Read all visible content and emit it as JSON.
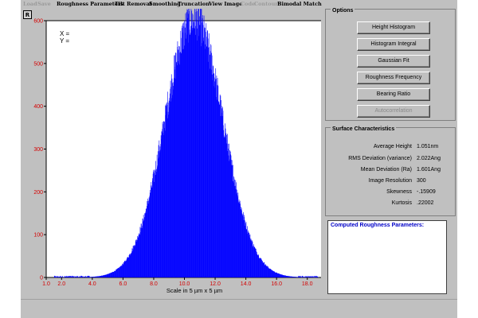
{
  "menu": [
    {
      "label": "Load",
      "enabled": false
    },
    {
      "label": "Save",
      "enabled": false
    },
    {
      "label": "Roughness Parameters",
      "enabled": true
    },
    {
      "label": "Tilt Removal",
      "enabled": true
    },
    {
      "label": "Smoothing",
      "enabled": true
    },
    {
      "label": "Truncation",
      "enabled": true
    },
    {
      "label": "View Image",
      "enabled": true
    },
    {
      "label": "Code",
      "enabled": false
    },
    {
      "label": "Contour",
      "enabled": false
    },
    {
      "label": "Bimodal Match",
      "enabled": true
    }
  ],
  "toolbar": {
    "r_label": "R"
  },
  "cursor_readout": {
    "x_label": "X =",
    "y_label": "Y ="
  },
  "chart_data": {
    "type": "bar",
    "title": "",
    "xlabel": "Scale in 5 µm x 5 µm",
    "ylabel": "",
    "xlim": [
      1.0,
      19.0
    ],
    "ylim": [
      0,
      600
    ],
    "x_ticks": [
      "1.0",
      "2.0",
      "4.0",
      "6.0",
      "8.0",
      "10.0",
      "12.0",
      "14.0",
      "16.0",
      "18.0"
    ],
    "y_ticks": [
      "0",
      "100",
      "200",
      "300",
      "400",
      "500",
      "600"
    ],
    "bar_color": "#0000ff",
    "tick_label_color": "#d40000",
    "grid": false,
    "distribution": {
      "shape": "approximately normal",
      "mean": 10.6,
      "std": 1.9,
      "peak_count": 605
    }
  },
  "options": {
    "title": "Options",
    "buttons": [
      {
        "label": "Height Histogram",
        "enabled": true
      },
      {
        "label": "Histogram Integral",
        "enabled": true
      },
      {
        "label": "Gaussian Fit",
        "enabled": true
      },
      {
        "label": "Roughness Frequency",
        "enabled": true
      },
      {
        "label": "Bearing Ratio",
        "enabled": true
      },
      {
        "label": "Autocorrelation",
        "enabled": false
      }
    ]
  },
  "surface": {
    "title": "Surface Characteristics",
    "rows": [
      {
        "label": "Average Height",
        "value": "1.051nm"
      },
      {
        "label": "RMS Deviation (variance)",
        "value": "2.022Ang"
      },
      {
        "label": "Mean Deviation (Ra)",
        "value": "1.601Ang"
      },
      {
        "label": "Image Resolution",
        "value": "300"
      },
      {
        "label": "Skewness",
        "value": "-.15909"
      },
      {
        "label": "Kurtosis",
        "value": ".22002"
      }
    ]
  },
  "roughness": {
    "title": "Computed Roughness Parameters:"
  },
  "colors": {
    "accent_blue": "#0000ff",
    "tick_red": "#d40000",
    "panel_gray": "#c0c0c0"
  }
}
